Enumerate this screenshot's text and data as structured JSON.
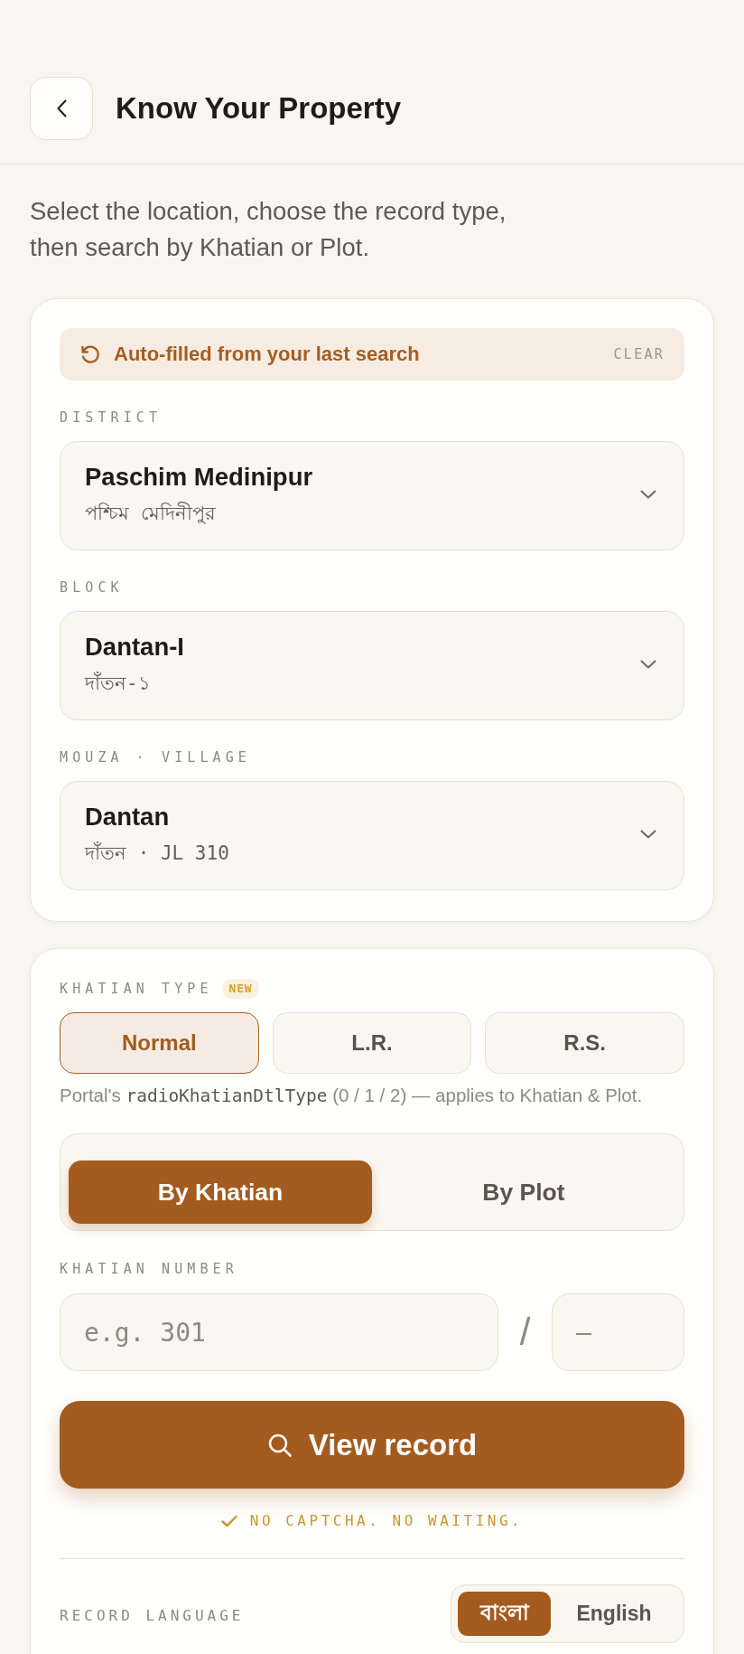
{
  "header": {
    "title": "Know Your Property"
  },
  "intro": "Select the location, choose the record type, then search by Khatian or Plot.",
  "location_card": {
    "notice": {
      "text": "Auto-filled from your last search",
      "action": "CLEAR"
    },
    "fields": [
      {
        "label": "DISTRICT",
        "value": "Paschim Medinipur",
        "subtitle": "পশ্চিম মেদিনীপুর"
      },
      {
        "label": "BLOCK",
        "value": "Dantan-I",
        "subtitle": "দাঁতন-১"
      },
      {
        "label": "MOUZA · VILLAGE",
        "value": "Dantan",
        "subtitle": "দাঁতন · JL 310"
      }
    ]
  },
  "search_card": {
    "khatian_type": {
      "label": "KHATIAN TYPE",
      "badge": "NEW",
      "options": [
        {
          "label": "Normal",
          "selected": true
        },
        {
          "label": "L.R.",
          "selected": false
        },
        {
          "label": "R.S.",
          "selected": false
        }
      ],
      "note": "Portal's **radioKhatianDtlType** (0 / 1 / 2) — applies to Khatian & Plot."
    },
    "search_mode": [
      {
        "label": "By Khatian",
        "selected": true
      },
      {
        "label": "By Plot",
        "selected": false
      }
    ],
    "number": {
      "label": "KHATIAN NUMBER",
      "fields": [
        {
          "placeholder": "e.g. 301"
        },
        {
          "placeholder": "—"
        }
      ],
      "separator": "/"
    },
    "submit": {
      "label": "View record"
    },
    "assurance": "NO CAPTCHA. NO WAITING.",
    "record_language": {
      "label": "RECORD LANGUAGE",
      "options": [
        {
          "label": "বাংলা",
          "selected": true
        },
        {
          "label": "English",
          "selected": false
        }
      ]
    }
  }
}
